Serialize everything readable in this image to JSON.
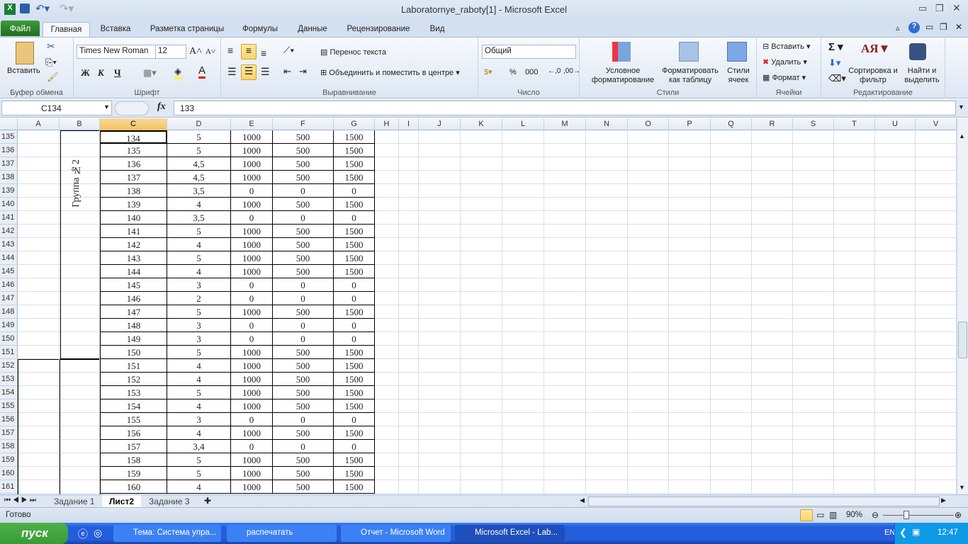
{
  "window": {
    "title": "Laboratornye_raboty[1]  -  Microsoft Excel"
  },
  "ribbon_tabs": [
    "Файл",
    "Главная",
    "Вставка",
    "Разметка страницы",
    "Формулы",
    "Данные",
    "Рецензирование",
    "Вид"
  ],
  "clipboard": {
    "paste": "Вставить",
    "group": "Буфер обмена"
  },
  "font": {
    "name": "Times New Roman",
    "size": "12",
    "bold": "Ж",
    "italic": "К",
    "underline": "Ч",
    "group": "Шрифт"
  },
  "alignment": {
    "wrap": "Перенос текста",
    "merge": "Объединить и поместить в центре",
    "group": "Выравнивание"
  },
  "number": {
    "format": "Общий",
    "percent": "%",
    "thousands": "000",
    "group": "Число"
  },
  "styles": {
    "conditional": "Условное форматирование",
    "table": "Форматировать как таблицу",
    "cell": "Стили ячеек",
    "group": "Стили"
  },
  "cells": {
    "insert": "Вставить",
    "delete": "Удалить",
    "format": "Формат",
    "group": "Ячейки"
  },
  "editing": {
    "sort": "Сортировка и фильтр",
    "find": "Найти и выделить",
    "group": "Редактирование"
  },
  "formula_bar": {
    "name_box": "C134",
    "fx": "fx",
    "value": "133"
  },
  "columns": [
    "A",
    "B",
    "C",
    "D",
    "E",
    "F",
    "G",
    "H",
    "I",
    "J",
    "K",
    "L",
    "M",
    "N",
    "O",
    "P",
    "Q",
    "R",
    "S",
    "T",
    "U",
    "V"
  ],
  "active_column": "C",
  "group_label": "Группа №2",
  "rows": [
    [
      135,
      "134",
      "5",
      "1000",
      "500",
      "1500"
    ],
    [
      136,
      "135",
      "5",
      "1000",
      "500",
      "1500"
    ],
    [
      137,
      "136",
      "4,5",
      "1000",
      "500",
      "1500"
    ],
    [
      138,
      "137",
      "4,5",
      "1000",
      "500",
      "1500"
    ],
    [
      139,
      "138",
      "3,5",
      "0",
      "0",
      "0"
    ],
    [
      140,
      "139",
      "4",
      "1000",
      "500",
      "1500"
    ],
    [
      141,
      "140",
      "3,5",
      "0",
      "0",
      "0"
    ],
    [
      142,
      "141",
      "5",
      "1000",
      "500",
      "1500"
    ],
    [
      143,
      "142",
      "4",
      "1000",
      "500",
      "1500"
    ],
    [
      144,
      "143",
      "5",
      "1000",
      "500",
      "1500"
    ],
    [
      145,
      "144",
      "4",
      "1000",
      "500",
      "1500"
    ],
    [
      146,
      "145",
      "3",
      "0",
      "0",
      "0"
    ],
    [
      147,
      "146",
      "2",
      "0",
      "0",
      "0"
    ],
    [
      148,
      "147",
      "5",
      "1000",
      "500",
      "1500"
    ],
    [
      149,
      "148",
      "3",
      "0",
      "0",
      "0"
    ],
    [
      150,
      "149",
      "3",
      "0",
      "0",
      "0"
    ],
    [
      151,
      "150",
      "5",
      "1000",
      "500",
      "1500"
    ],
    [
      152,
      "151",
      "4",
      "1000",
      "500",
      "1500"
    ],
    [
      153,
      "152",
      "4",
      "1000",
      "500",
      "1500"
    ],
    [
      154,
      "153",
      "5",
      "1000",
      "500",
      "1500"
    ],
    [
      155,
      "154",
      "4",
      "1000",
      "500",
      "1500"
    ],
    [
      156,
      "155",
      "3",
      "0",
      "0",
      "0"
    ],
    [
      157,
      "156",
      "4",
      "1000",
      "500",
      "1500"
    ],
    [
      158,
      "157",
      "3,4",
      "0",
      "0",
      "0"
    ],
    [
      159,
      "158",
      "5",
      "1000",
      "500",
      "1500"
    ],
    [
      160,
      "159",
      "5",
      "1000",
      "500",
      "1500"
    ],
    [
      161,
      "160",
      "4",
      "1000",
      "500",
      "1500"
    ]
  ],
  "sheets": [
    "Задание 1",
    "Лист2",
    "Задание 3"
  ],
  "active_sheet": "Лист2",
  "status": {
    "ready": "Готово",
    "zoom": "90%",
    "zoom_level": 90
  },
  "taskbar": {
    "start": "пуск",
    "tasks": [
      "Тема: Система упра...",
      "распечатать",
      "Отчет - Microsoft Word",
      "Microsoft Excel - Lab..."
    ],
    "lang": "EN",
    "clock": "12:47"
  }
}
